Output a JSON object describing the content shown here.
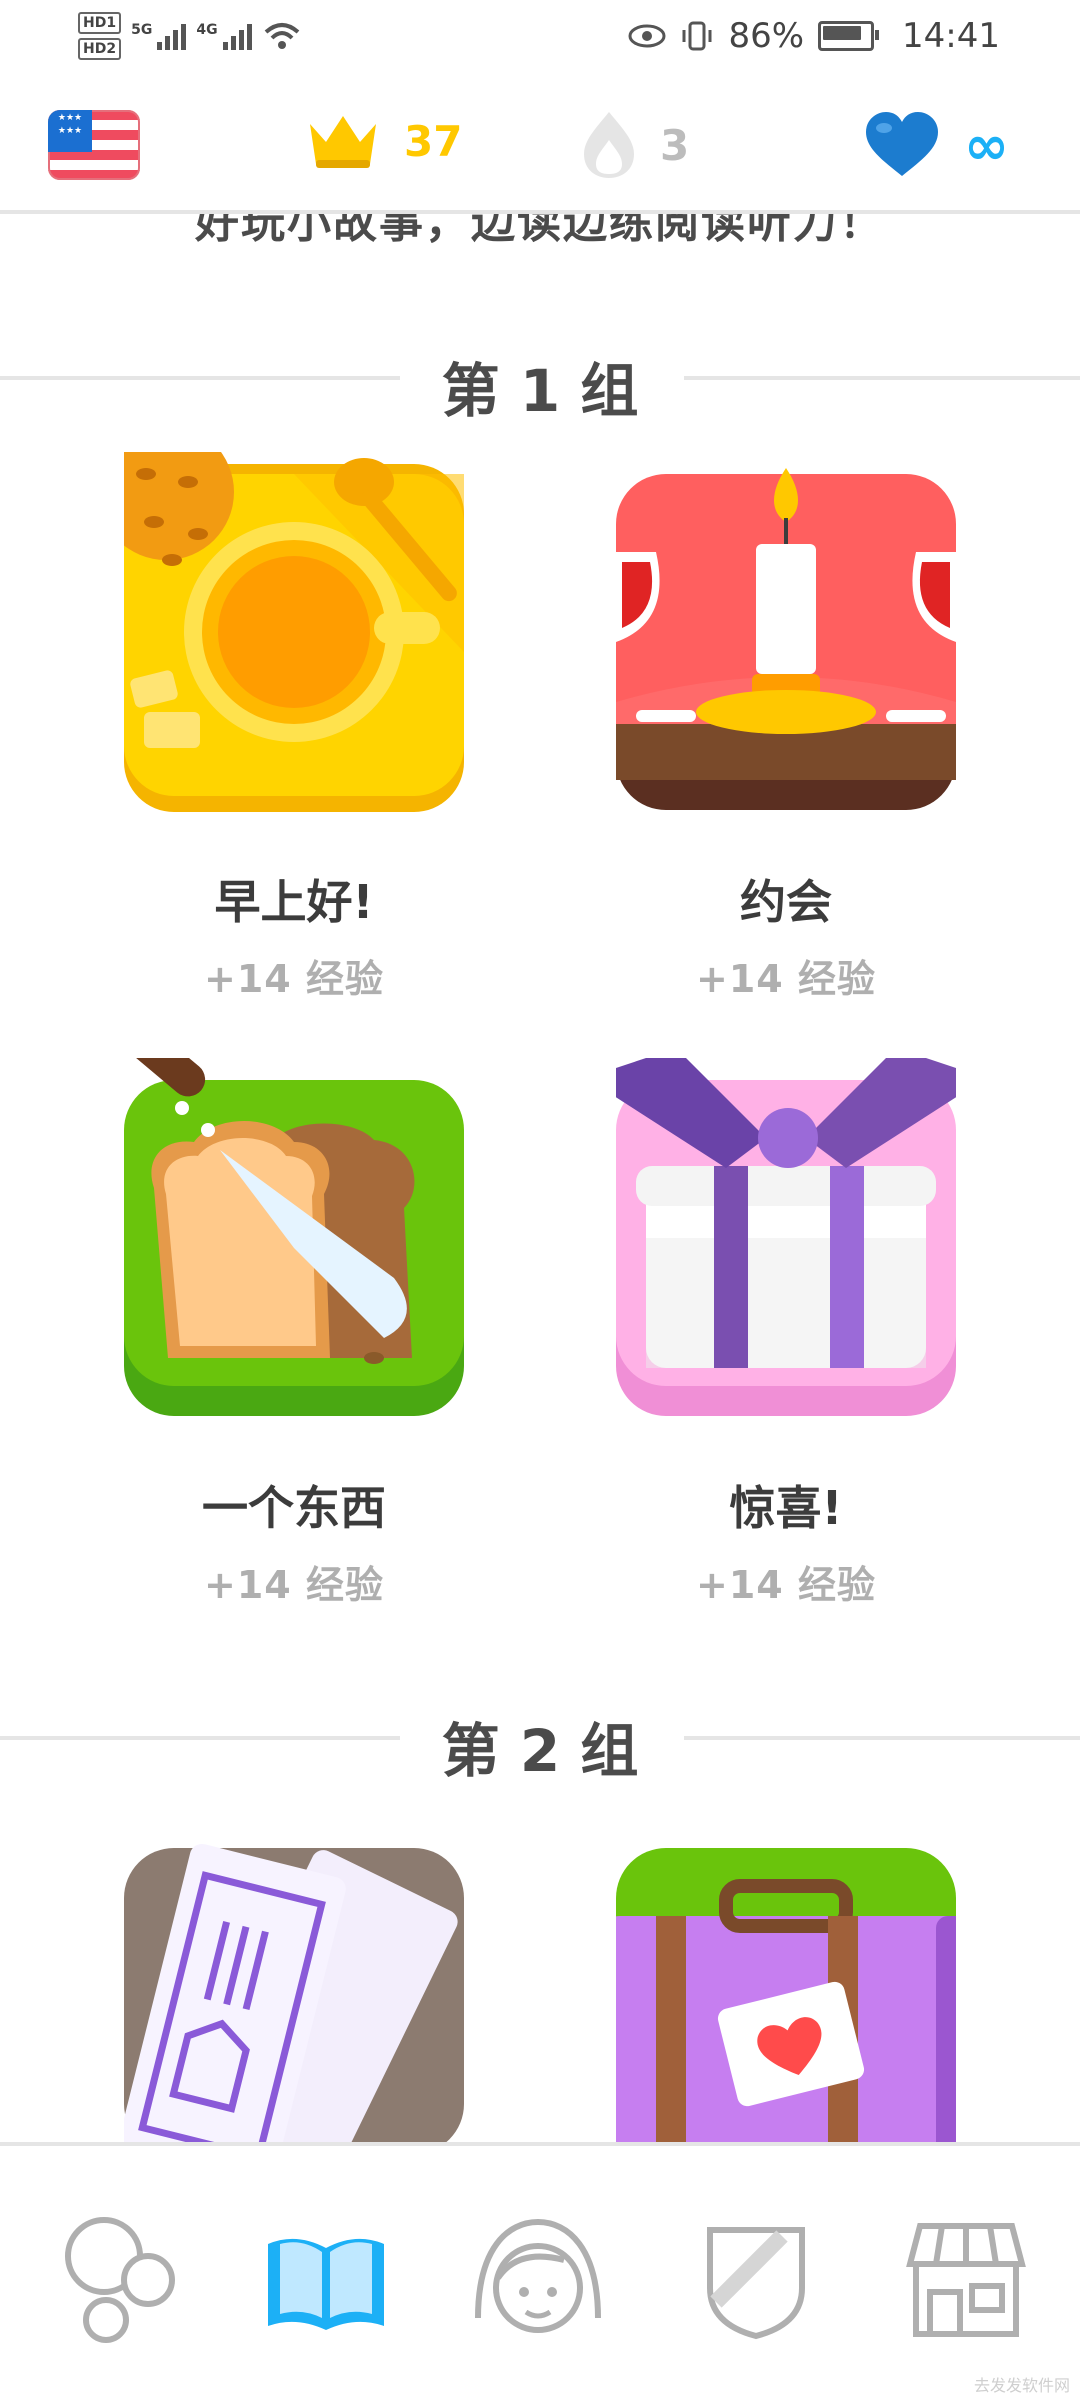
{
  "status_bar": {
    "hd1": "HD1",
    "hd2": "HD2",
    "net1": "5G",
    "net2": "4G",
    "battery": "86%",
    "time": "14:41"
  },
  "top_bar": {
    "course_flag": "us-flag-icon",
    "crowns": "37",
    "streak": "3",
    "hearts": "∞"
  },
  "intro_text": "好玩小故事，边读边练阅读听力！",
  "sections": [
    {
      "title": "第 1 组",
      "skills": [
        {
          "name": "早上好!",
          "xp": "+14 经验",
          "icon": "coffee-cup-icon"
        },
        {
          "name": "约会",
          "xp": "+14 经验",
          "icon": "candle-dinner-icon"
        },
        {
          "name": "一个东西",
          "xp": "+14 经验",
          "icon": "bread-knife-icon"
        },
        {
          "name": "惊喜!",
          "xp": "+14 经验",
          "icon": "gift-box-icon"
        }
      ]
    },
    {
      "title": "第 2 组",
      "skills": [
        {
          "icon": "tickets-icon"
        },
        {
          "icon": "suitcase-icon"
        }
      ]
    }
  ],
  "bottom_nav": [
    {
      "name": "learn-tab",
      "icon": "bubbles-icon",
      "active": false
    },
    {
      "name": "stories-tab",
      "icon": "open-book-icon",
      "active": true
    },
    {
      "name": "profile-tab",
      "icon": "avatar-icon",
      "active": false
    },
    {
      "name": "leagues-tab",
      "icon": "shield-icon",
      "active": false
    },
    {
      "name": "shop-tab",
      "icon": "shop-icon",
      "active": false
    }
  ],
  "watermark": "去发发软件网",
  "colors": {
    "crown": "#ffc800",
    "hearts": "#1cb0f6",
    "muted": "#afafaf",
    "active_tab": "#1cb0f6"
  }
}
